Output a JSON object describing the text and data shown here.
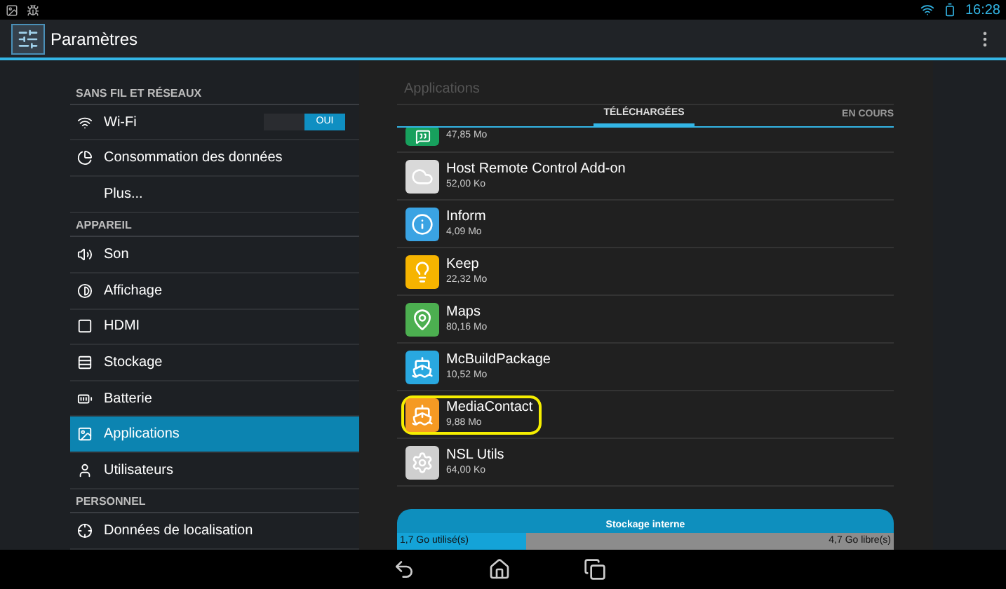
{
  "status_bar": {
    "time": "16:28"
  },
  "action_bar": {
    "title": "Paramètres"
  },
  "sidebar": {
    "items": [
      {
        "kind": "header",
        "label": "SANS FIL ET RÉSEAUX"
      },
      {
        "kind": "item",
        "label": "Wi-Fi",
        "selected": false,
        "toggle": {
          "label": "OUI",
          "on": true
        }
      },
      {
        "kind": "item",
        "label": "Consommation des données",
        "selected": false
      },
      {
        "kind": "item",
        "label": "Plus...",
        "selected": false
      },
      {
        "kind": "header",
        "label": "APPAREIL"
      },
      {
        "kind": "item",
        "label": "Son",
        "selected": false
      },
      {
        "kind": "item",
        "label": "Affichage",
        "selected": false
      },
      {
        "kind": "item",
        "label": "HDMI",
        "selected": false
      },
      {
        "kind": "item",
        "label": "Stockage",
        "selected": false
      },
      {
        "kind": "item",
        "label": "Batterie",
        "selected": false
      },
      {
        "kind": "item",
        "label": "Applications",
        "selected": true
      },
      {
        "kind": "item",
        "label": "Utilisateurs",
        "selected": false
      },
      {
        "kind": "header",
        "label": "PERSONNEL"
      },
      {
        "kind": "item",
        "label": "Données de localisation",
        "selected": false
      }
    ]
  },
  "content": {
    "title": "Applications",
    "tabs": [
      {
        "label": "TÉLÉCHARGÉES",
        "selected": true
      },
      {
        "label": "EN COURS",
        "selected": false
      }
    ],
    "apps": [
      {
        "size": "47,85 Mo",
        "highlighted": false
      },
      {
        "name": "Host Remote Control Add-on",
        "size": "52,00 Ko",
        "highlighted": false
      },
      {
        "name": "Inform",
        "size": "4,09 Mo",
        "highlighted": false
      },
      {
        "name": "Keep",
        "size": "22,32 Mo",
        "highlighted": false
      },
      {
        "name": "Maps",
        "size": "80,16 Mo",
        "highlighted": false
      },
      {
        "name": "McBuildPackage",
        "size": "10,52 Mo",
        "highlighted": false
      },
      {
        "name": "MediaContact",
        "size": "9,88 Mo",
        "highlighted": true
      },
      {
        "name": "NSL Utils",
        "size": "64,00 Ko",
        "highlighted": false
      }
    ],
    "storage": {
      "label": "Stockage interne",
      "used": "1,7 Go utilisé(s)",
      "free": "4,7 Go libre(s)",
      "level": 0.26
    }
  }
}
